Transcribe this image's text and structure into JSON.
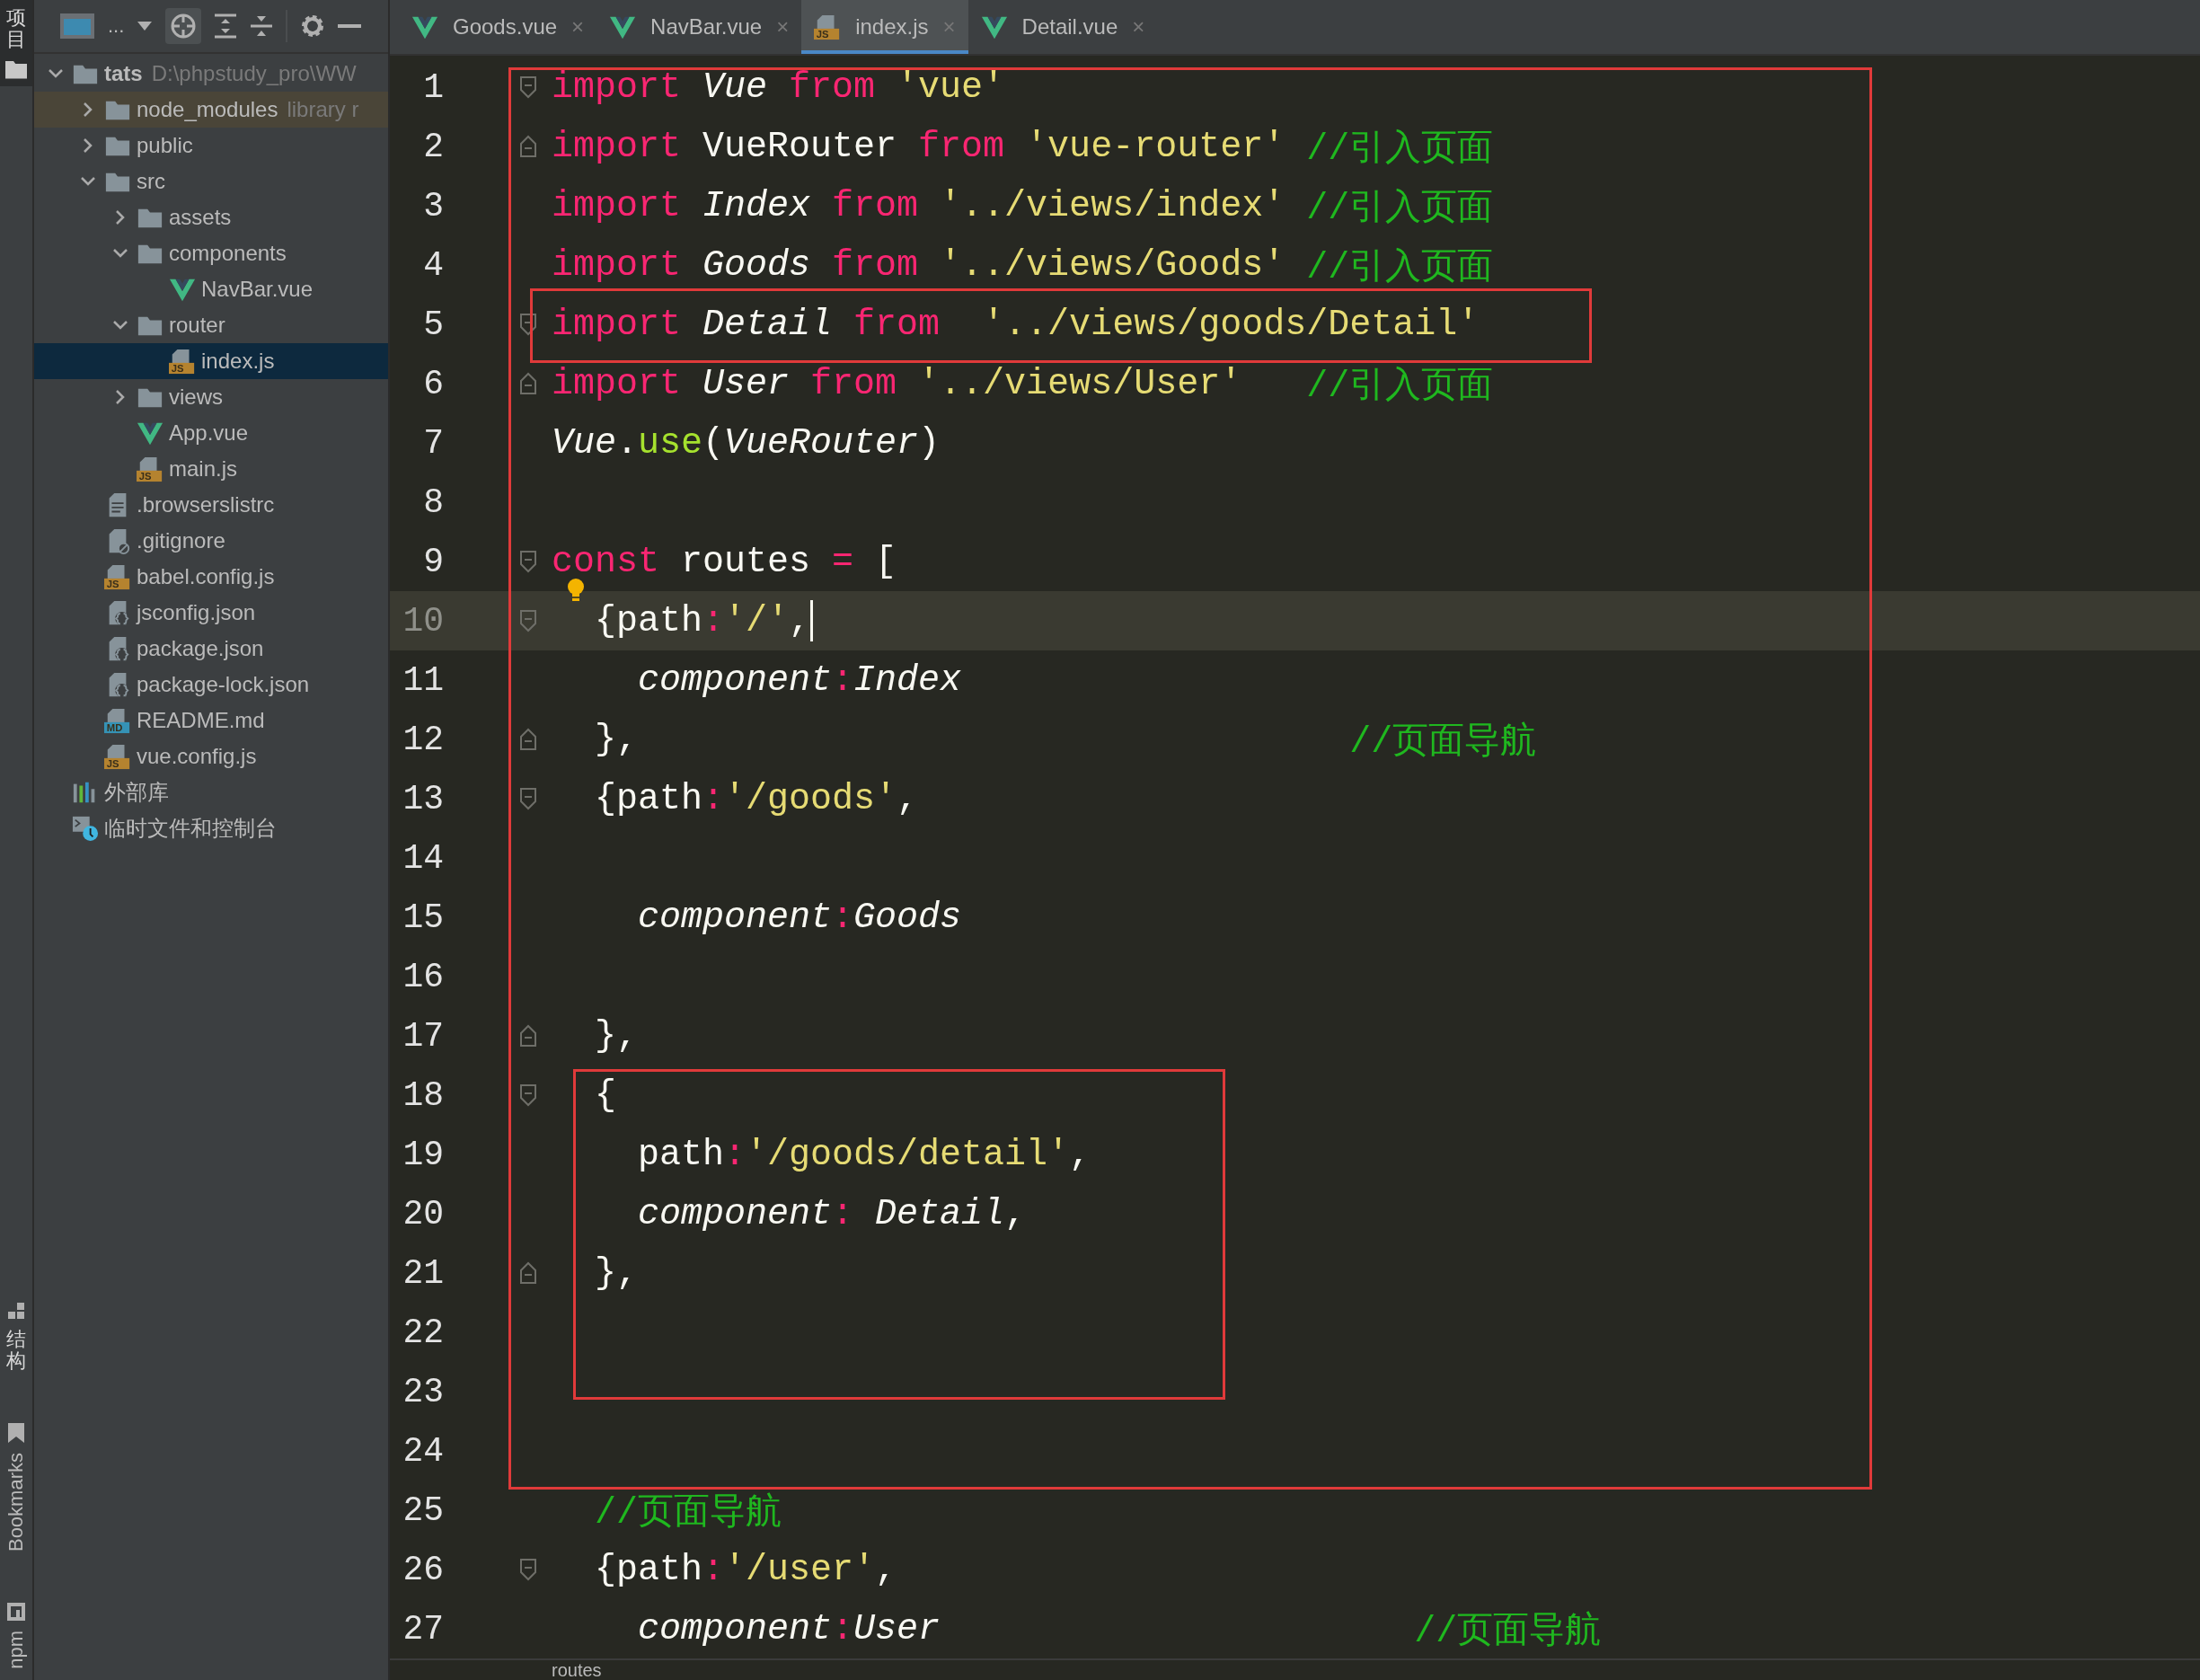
{
  "tool_strip": [
    {
      "label": "项目",
      "kind": "folder",
      "selected": true
    },
    {
      "label": "结构",
      "kind": "structure",
      "selected": false
    },
    {
      "label": "Bookmarks",
      "kind": "bookmark",
      "selected": false
    },
    {
      "label": "npm",
      "kind": "npm",
      "selected": false
    }
  ],
  "project_toolbar": {
    "view_label": "..."
  },
  "tree": [
    {
      "name": "tats",
      "hint": "D:\\phpstudy_pro\\WW",
      "kind": "folder",
      "bold": true,
      "expanded": true,
      "selected": false,
      "children": [
        {
          "name": "node_modules",
          "hint": "library r",
          "kind": "folder",
          "library_root": true,
          "expanded": false,
          "selected": false
        },
        {
          "name": "public",
          "kind": "folder",
          "expanded": false,
          "selected": false
        },
        {
          "name": "src",
          "kind": "folder",
          "expanded": true,
          "selected": false,
          "children": [
            {
              "name": "assets",
              "kind": "folder",
              "expanded": false,
              "selected": false
            },
            {
              "name": "components",
              "kind": "folder",
              "expanded": true,
              "selected": false,
              "children": [
                {
                  "name": "NavBar.vue",
                  "kind": "vue",
                  "selected": false
                }
              ]
            },
            {
              "name": "router",
              "kind": "folder",
              "expanded": true,
              "selected": false,
              "children": [
                {
                  "name": "index.js",
                  "kind": "js",
                  "badge": "JS",
                  "selected": true
                }
              ]
            },
            {
              "name": "views",
              "kind": "folder",
              "expanded": false,
              "selected": false
            },
            {
              "name": "App.vue",
              "kind": "vue",
              "selected": false
            },
            {
              "name": "main.js",
              "kind": "js",
              "badge": "JS",
              "selected": false
            }
          ]
        },
        {
          "name": ".browserslistrc",
          "kind": "text",
          "selected": false
        },
        {
          "name": ".gitignore",
          "kind": "ignore",
          "selected": false
        },
        {
          "name": "babel.config.js",
          "kind": "js",
          "badge": "JS",
          "selected": false
        },
        {
          "name": "jsconfig.json",
          "kind": "json",
          "selected": false
        },
        {
          "name": "package.json",
          "kind": "json",
          "selected": false
        },
        {
          "name": "package-lock.json",
          "kind": "json",
          "selected": false
        },
        {
          "name": "README.md",
          "kind": "md",
          "badge": "MD",
          "selected": false
        },
        {
          "name": "vue.config.js",
          "kind": "js",
          "badge": "JS",
          "selected": false
        }
      ]
    },
    {
      "name": "外部库",
      "kind": "library",
      "selected": false
    },
    {
      "name": "临时文件和控制台",
      "kind": "scratch",
      "selected": false
    }
  ],
  "tabs": [
    {
      "label": "Goods.vue",
      "kind": "vue",
      "close": "×",
      "selected": false
    },
    {
      "label": "NavBar.vue",
      "kind": "vue",
      "close": "×",
      "selected": false
    },
    {
      "label": "index.js",
      "kind": "js",
      "badge": "JS",
      "close": "×",
      "selected": true
    },
    {
      "label": "Detail.vue",
      "kind": "vue",
      "close": "×",
      "selected": false
    }
  ],
  "editor": {
    "lines": [
      {
        "number": "1",
        "fold_start": true,
        "fold_end": false,
        "current": false,
        "tokens": [
          {
            "kind": "kw",
            "text": "import"
          },
          {
            "kind": "it",
            "text": " Vue"
          },
          {
            "kind": "kw",
            "text": " from"
          },
          {
            "kind": "str",
            "text": " 'vue'"
          }
        ]
      },
      {
        "number": "2",
        "fold_start": false,
        "fold_end": true,
        "current": false,
        "tokens": [
          {
            "kind": "kw",
            "text": "import"
          },
          {
            "kind": "id",
            "text": " VueRouter"
          },
          {
            "kind": "kw",
            "text": " from"
          },
          {
            "kind": "str",
            "text": " 'vue-router'"
          },
          {
            "kind": "cm",
            "text": " //引入页面"
          }
        ]
      },
      {
        "number": "3",
        "fold_start": false,
        "fold_end": false,
        "current": false,
        "tokens": [
          {
            "kind": "kw",
            "text": "import"
          },
          {
            "kind": "it",
            "text": " Index"
          },
          {
            "kind": "kw",
            "text": " from"
          },
          {
            "kind": "str",
            "text": " '../views/index'"
          },
          {
            "kind": "cm",
            "text": " //引入页面"
          }
        ]
      },
      {
        "number": "4",
        "fold_start": false,
        "fold_end": false,
        "current": false,
        "tokens": [
          {
            "kind": "kw",
            "text": "import"
          },
          {
            "kind": "it",
            "text": " Goods"
          },
          {
            "kind": "kw",
            "text": " from"
          },
          {
            "kind": "str",
            "text": " '../views/Goods'"
          },
          {
            "kind": "cm",
            "text": " //引入页面"
          }
        ]
      },
      {
        "number": "5",
        "fold_start": true,
        "fold_end": false,
        "current": false,
        "tokens": [
          {
            "kind": "kw",
            "text": "import"
          },
          {
            "kind": "it",
            "text": " Detail"
          },
          {
            "kind": "kw",
            "text": " from"
          },
          {
            "kind": "str",
            "text": "  '../views/goods/Detail'"
          }
        ]
      },
      {
        "number": "6",
        "fold_start": false,
        "fold_end": true,
        "current": false,
        "tokens": [
          {
            "kind": "kw",
            "text": "import"
          },
          {
            "kind": "it",
            "text": " User"
          },
          {
            "kind": "kw",
            "text": " from"
          },
          {
            "kind": "str",
            "text": " '../views/User'"
          },
          {
            "kind": "cm",
            "text": "   //引入页面"
          }
        ]
      },
      {
        "number": "7",
        "fold_start": false,
        "fold_end": false,
        "current": false,
        "tokens": [
          {
            "kind": "it",
            "text": "Vue"
          },
          {
            "kind": "p",
            "text": "."
          },
          {
            "kind": "fn",
            "text": "use"
          },
          {
            "kind": "p",
            "text": "("
          },
          {
            "kind": "it",
            "text": "VueRouter"
          },
          {
            "kind": "p",
            "text": ")"
          }
        ]
      },
      {
        "number": "8",
        "fold_start": false,
        "fold_end": false,
        "current": false
      },
      {
        "number": "9",
        "fold_start": true,
        "fold_end": false,
        "current": false,
        "bulb": true,
        "tokens": [
          {
            "kind": "kw",
            "text": "const"
          },
          {
            "kind": "id",
            "text": " routes"
          },
          {
            "kind": "op",
            "text": " ="
          },
          {
            "kind": "p",
            "text": " ["
          }
        ]
      },
      {
        "number": "10",
        "fold_start": true,
        "fold_end": false,
        "current": true,
        "caret": true,
        "tokens": [
          {
            "kind": "p",
            "text": "  {path"
          },
          {
            "kind": "op",
            "text": ":"
          },
          {
            "kind": "str",
            "text": "'/'"
          },
          {
            "kind": "p",
            "text": ","
          }
        ]
      },
      {
        "number": "11",
        "fold_start": false,
        "fold_end": false,
        "current": false,
        "tokens": [
          {
            "kind": "it",
            "text": "    component"
          },
          {
            "kind": "op",
            "text": ":"
          },
          {
            "kind": "it",
            "text": "Index"
          }
        ]
      },
      {
        "number": "12",
        "fold_start": false,
        "fold_end": true,
        "current": false,
        "tokens": [
          {
            "kind": "p",
            "text": "  },"
          },
          {
            "kind": "cm",
            "text": "                                 //页面导航"
          }
        ]
      },
      {
        "number": "13",
        "fold_start": true,
        "fold_end": false,
        "current": false,
        "tokens": [
          {
            "kind": "p",
            "text": "  {path"
          },
          {
            "kind": "op",
            "text": ":"
          },
          {
            "kind": "str",
            "text": "'/goods'"
          },
          {
            "kind": "p",
            "text": ","
          }
        ]
      },
      {
        "number": "14",
        "fold_start": false,
        "fold_end": false,
        "current": false
      },
      {
        "number": "15",
        "fold_start": false,
        "fold_end": false,
        "current": false,
        "tokens": [
          {
            "kind": "it",
            "text": "    component"
          },
          {
            "kind": "op",
            "text": ":"
          },
          {
            "kind": "it",
            "text": "Goods"
          }
        ]
      },
      {
        "number": "16",
        "fold_start": false,
        "fold_end": false,
        "current": false
      },
      {
        "number": "17",
        "fold_start": false,
        "fold_end": true,
        "current": false,
        "tokens": [
          {
            "kind": "p",
            "text": "  },"
          }
        ]
      },
      {
        "number": "18",
        "fold_start": true,
        "fold_end": false,
        "current": false,
        "tokens": [
          {
            "kind": "p",
            "text": "  {"
          }
        ]
      },
      {
        "number": "19",
        "fold_start": false,
        "fold_end": false,
        "current": false,
        "tokens": [
          {
            "kind": "p",
            "text": "    path"
          },
          {
            "kind": "op",
            "text": ":"
          },
          {
            "kind": "str",
            "text": "'/goods/detail'"
          },
          {
            "kind": "p",
            "text": ","
          }
        ]
      },
      {
        "number": "20",
        "fold_start": false,
        "fold_end": false,
        "current": false,
        "tokens": [
          {
            "kind": "it",
            "text": "    component"
          },
          {
            "kind": "op",
            "text": ":"
          },
          {
            "kind": "it",
            "text": " Detail"
          },
          {
            "kind": "p",
            "text": ","
          }
        ]
      },
      {
        "number": "21",
        "fold_start": false,
        "fold_end": true,
        "current": false,
        "tokens": [
          {
            "kind": "p",
            "text": "  },"
          }
        ]
      },
      {
        "number": "22",
        "fold_start": false,
        "fold_end": false,
        "current": false
      },
      {
        "number": "23",
        "fold_start": false,
        "fold_end": false,
        "current": false
      },
      {
        "number": "24",
        "fold_start": false,
        "fold_end": false,
        "current": false
      },
      {
        "number": "25",
        "fold_start": false,
        "fold_end": false,
        "current": false,
        "tokens": [
          {
            "kind": "cm",
            "text": "  //页面导航"
          }
        ]
      },
      {
        "number": "26",
        "fold_start": true,
        "fold_end": false,
        "current": false,
        "tokens": [
          {
            "kind": "p",
            "text": "  {path"
          },
          {
            "kind": "op",
            "text": ":"
          },
          {
            "kind": "str",
            "text": "'/user'"
          },
          {
            "kind": "p",
            "text": ","
          }
        ]
      },
      {
        "number": "27",
        "fold_start": false,
        "fold_end": false,
        "current": false,
        "tokens": [
          {
            "kind": "it",
            "text": "    component"
          },
          {
            "kind": "op",
            "text": ":"
          },
          {
            "kind": "it",
            "text": "User"
          },
          {
            "kind": "cm",
            "text": "                      //页面导航"
          }
        ]
      }
    ],
    "breadcrumb": "routes"
  }
}
